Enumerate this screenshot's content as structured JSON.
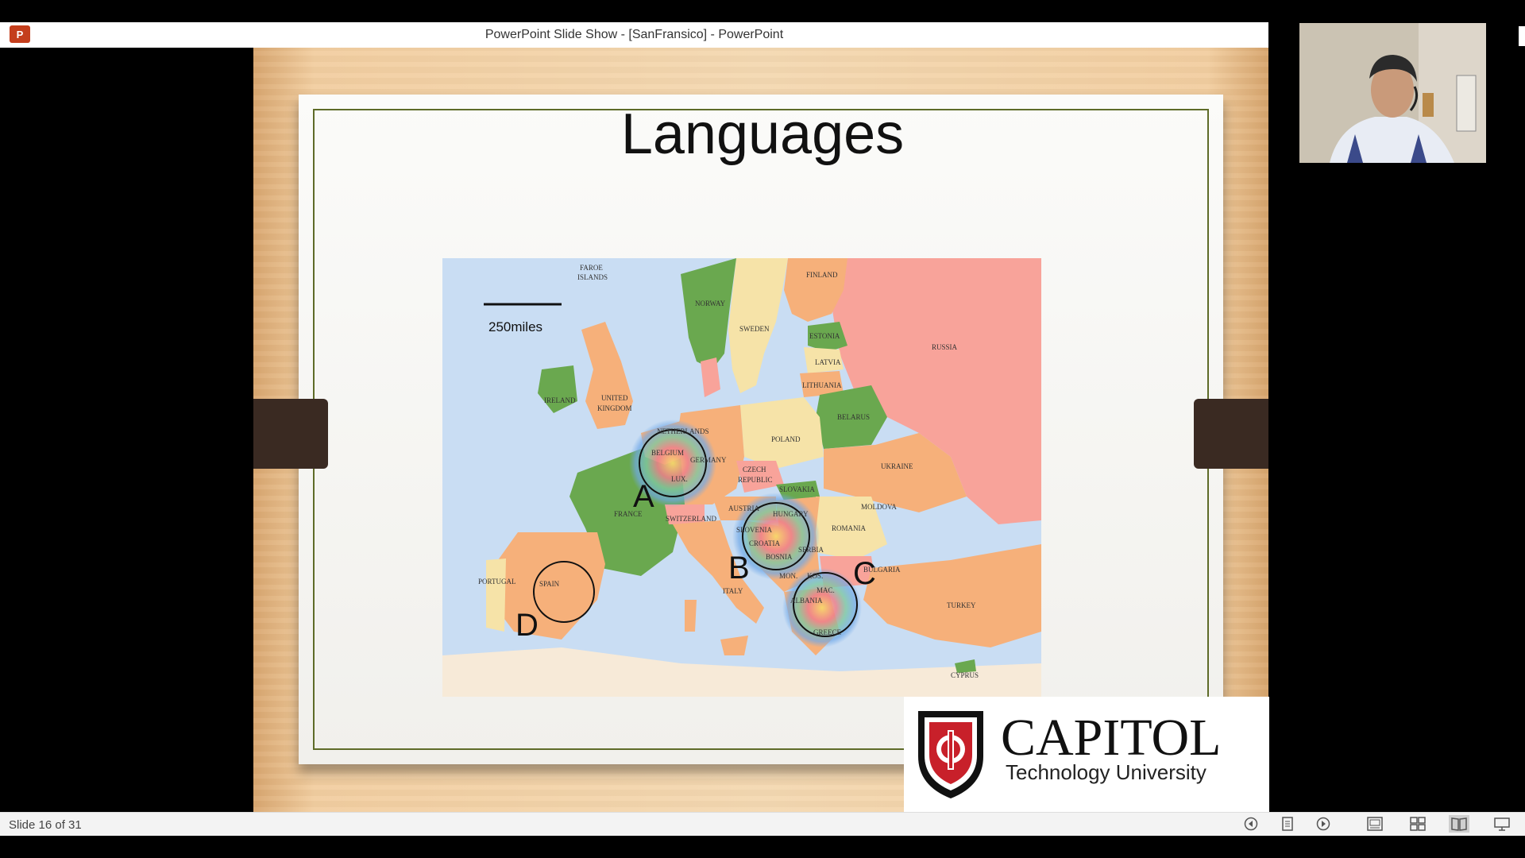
{
  "window": {
    "app_icon": "P",
    "title": "PowerPoint Slide Show - [SanFransico] - PowerPoint"
  },
  "slide": {
    "title": "Languages",
    "scale_label": "250miles",
    "map_labels": {
      "faroe1": "FAROE",
      "faroe2": "ISLANDS",
      "norway": "NORWAY",
      "sweden": "SWEDEN",
      "finland": "FINLAND",
      "russia": "RUSSIA",
      "estonia": "ESTONIA",
      "latvia": "LATVIA",
      "lithuania": "LITHUANIA",
      "belarus": "BELARUS",
      "ireland": "IRELAND",
      "uk1": "UNITED",
      "uk2": "KINGDOM",
      "netherlands": "NETHERLANDS",
      "belgium": "BELGIUM",
      "germany": "GERMANY",
      "lux": "LUX.",
      "poland": "POLAND",
      "ukraine": "UKRAINE",
      "czech1": "CZECH",
      "czech2": "REPUBLIC",
      "slovakia": "SLOVAKIA",
      "austria": "AUSTRIA",
      "hungary": "HUNGARY",
      "moldova": "MOLDOVA",
      "romania": "ROMANIA",
      "france": "FRANCE",
      "switzerland": "SWITZERLAND",
      "slovenia": "SLOVENIA",
      "croatia": "CROATIA",
      "bosnia": "BOSNIA",
      "serbia": "SERBIA",
      "bulgaria": "BULGARIA",
      "portugal": "PORTUGAL",
      "spain": "SPAIN",
      "italy": "ITALY",
      "mon": "MON.",
      "kos": "KOS.",
      "mac": "MAC.",
      "albania": "ALBANIA",
      "greece": "GREECE",
      "turkey": "TURKEY",
      "cyprus": "CYPRUS"
    },
    "markers": [
      "A",
      "B",
      "C",
      "D"
    ]
  },
  "logo": {
    "name": "CAPITOL",
    "subtitle": "Technology University"
  },
  "status_bar": {
    "slide_counter": "Slide 16 of 31",
    "icons": [
      "previous-icon",
      "notes-icon",
      "next-icon",
      "normal-view-icon",
      "slide-sorter-icon",
      "reading-view-icon",
      "slideshow-icon"
    ]
  },
  "colors": {
    "map_sea": "#c9ddf3",
    "map_green": "#6aa84f",
    "map_orange": "#f6b07a",
    "map_yellow": "#f6e3a8",
    "map_red": "#f8a39a",
    "logo_red": "#c8202a",
    "frame_green": "#5e6b28"
  }
}
